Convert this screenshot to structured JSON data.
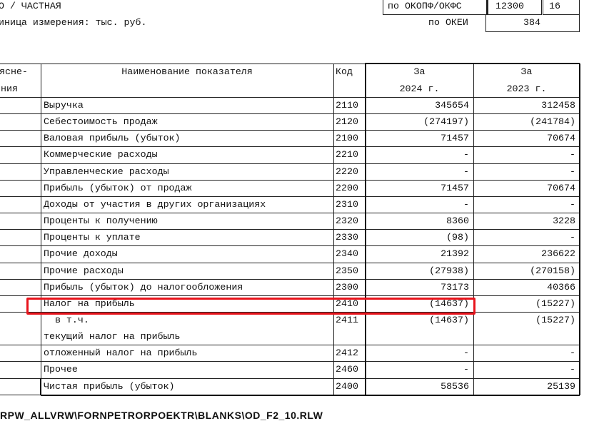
{
  "header": {
    "ownership": "О / ЧАСТНАЯ",
    "okopf_label": "по ОКОПФ/ОКФС",
    "okopf_code": "12300",
    "okfs_code": "16",
    "unit_label": "иница измерения: тыс. руб.",
    "okei_label": "по ОКЕИ",
    "okei_code": "384"
  },
  "table": {
    "col_note_line1": "ясне-",
    "col_note_line2": "ния",
    "col_name": "Наименование показателя",
    "col_code": "Код",
    "col_2024_line1": "За",
    "col_2024_line2": "2024 г.",
    "col_2023_line1": "За",
    "col_2023_line2": "2023 г.",
    "rows": [
      {
        "name": "Выручка",
        "code": "2110",
        "v2024": "345654",
        "v2023": "312458"
      },
      {
        "name": "Себестоимость продаж",
        "code": "2120",
        "v2024": "(274197)",
        "v2023": "(241784)"
      },
      {
        "name": "Валовая прибыль (убыток)",
        "code": "2100",
        "v2024": "71457",
        "v2023": "70674"
      },
      {
        "name": "Коммерческие расходы",
        "code": "2210",
        "v2024": "-",
        "v2023": "-"
      },
      {
        "name": "Управленческие расходы",
        "code": "2220",
        "v2024": "-",
        "v2023": "-"
      },
      {
        "name": "Прибыль (убыток) от продаж",
        "code": "2200",
        "v2024": "71457",
        "v2023": "70674"
      },
      {
        "name": "Доходы от участия в других организациях",
        "code": "2310",
        "v2024": "-",
        "v2023": "-"
      },
      {
        "name": "Проценты к получению",
        "code": "2320",
        "v2024": "8360",
        "v2023": "3228"
      },
      {
        "name": "Проценты к уплате",
        "code": "2330",
        "v2024": "(98)",
        "v2023": "-"
      },
      {
        "name": "Прочие доходы",
        "code": "2340",
        "v2024": "21392",
        "v2023": "236622"
      },
      {
        "name": "Прочие расходы",
        "code": "2350",
        "v2024": "(27938)",
        "v2023": "(270158)"
      },
      {
        "name": "Прибыль (убыток) до налогообложения",
        "code": "2300",
        "v2024": "73173",
        "v2023": "40366"
      },
      {
        "name": "Налог на прибыль",
        "code": "2410",
        "v2024": "(14637)",
        "v2023": "(15227)"
      }
    ],
    "current_tax_prefix": "  в т.ч.",
    "current_tax_name": "текущий налог на прибыль",
    "current_tax_code": "2411",
    "current_tax_v2024": "(14637)",
    "current_tax_v2023": "(15227)",
    "rows_after": [
      {
        "name": "отложенный налог на прибыль",
        "code": "2412",
        "v2024": "-",
        "v2023": "-"
      },
      {
        "name": "Прочее",
        "code": "2460",
        "v2024": "-",
        "v2023": "-"
      },
      {
        "name": "Чистая прибыль (убыток)",
        "code": "2400",
        "v2024": "58536",
        "v2023": "25139"
      }
    ]
  },
  "footer": "RPW_ALLVRW\\FORNPETRORPOEKTR\\BLANKS\\OD_F2_10.RLW",
  "colors": {
    "highlight": "#e8141c"
  }
}
